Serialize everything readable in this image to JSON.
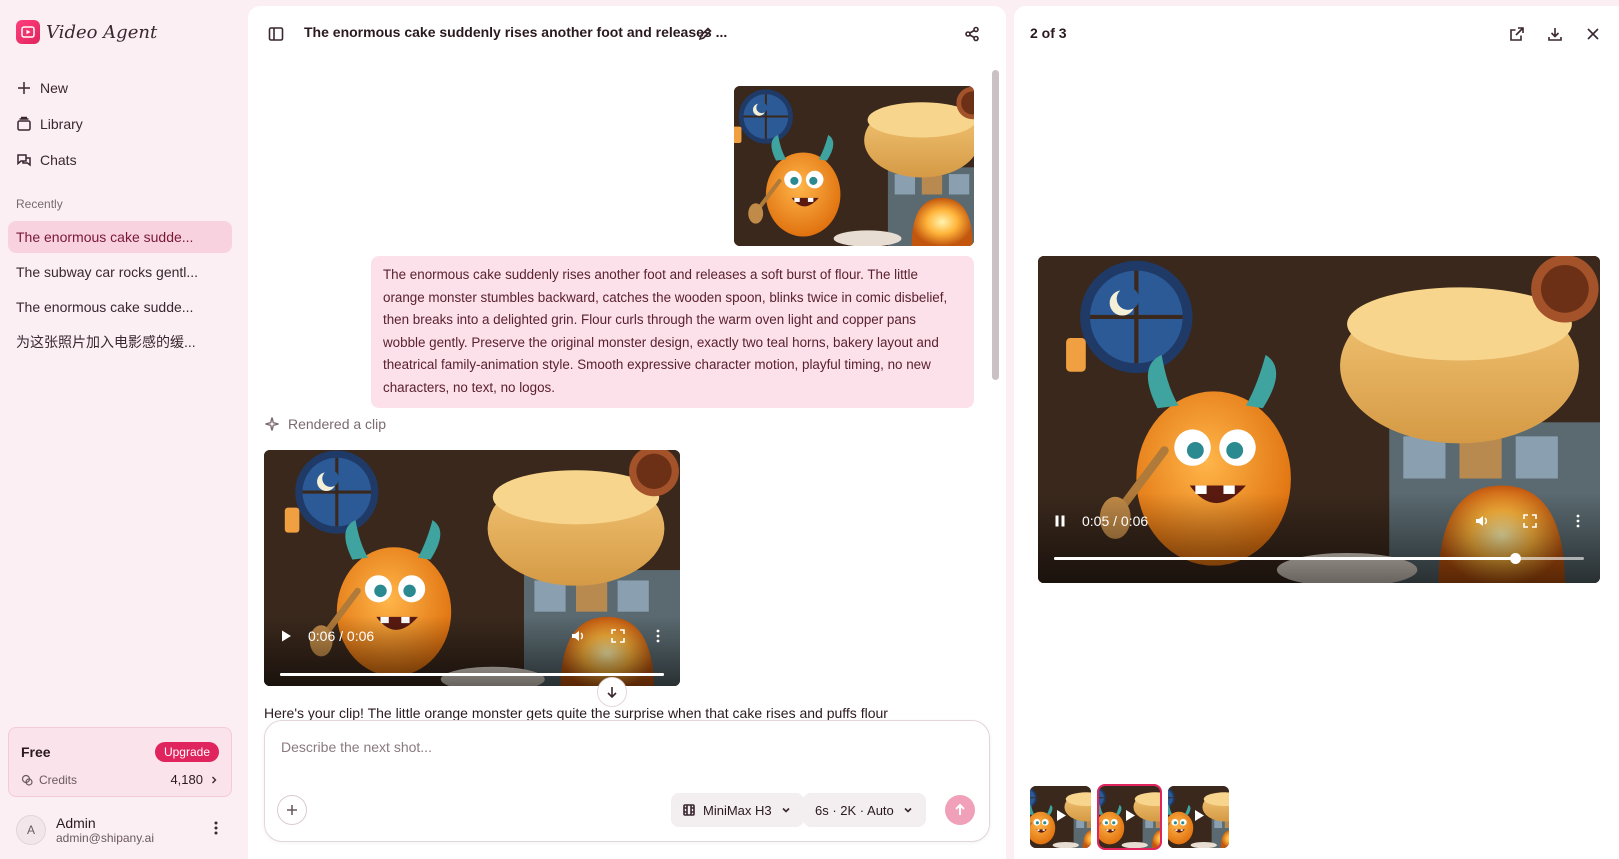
{
  "app": {
    "name": "Video Agent",
    "brand_color": "#e0245e"
  },
  "nav": [
    {
      "label": "New",
      "icon": "plus-icon"
    },
    {
      "label": "Library",
      "icon": "library-icon"
    },
    {
      "label": "Chats",
      "icon": "chats-icon"
    }
  ],
  "recent": {
    "label": "Recently",
    "items": [
      {
        "label": "The enormous cake sudde...",
        "active": true
      },
      {
        "label": "The subway car rocks gentl...",
        "active": false
      },
      {
        "label": "The enormous cake sudde...",
        "active": false
      },
      {
        "label": "为这张照片加入电影感的缓...",
        "active": false
      }
    ]
  },
  "plan": {
    "name": "Free",
    "upgrade_label": "Upgrade",
    "credits_label": "Credits",
    "credits_value": "4,180"
  },
  "user": {
    "initial": "A",
    "name": "Admin",
    "email": "admin@shipany.ai"
  },
  "chat": {
    "title": "The enormous cake suddenly rises another foot and releases ...",
    "message": "The enormous cake suddenly rises another foot and releases a soft burst of flour. The little orange monster stumbles backward, catches the wooden spoon, blinks twice in comic disbelief, then breaks into a delighted grin. Flour curls through the warm oven light and copper pans wobble gently. Preserve the original monster design, exactly two teal horns, bakery layout and theatrical family-animation style. Smooth expressive character motion, playful timing, no new characters, no text, no logos.",
    "rendered_label": "Rendered a clip",
    "clip_time": "0:06",
    "clip_duration": "0:06",
    "clip_progress": 1.0,
    "assistant_text": "Here's your clip! The little orange monster gets quite the surprise when that cake rises and puffs flour",
    "composer_placeholder": "Describe the next shot...",
    "model_label": "MiniMax H3",
    "settings_label": "6s · 2K · Auto"
  },
  "preview": {
    "count_label": "2 of 3",
    "time": "0:05",
    "duration": "0:06",
    "progress": 0.87,
    "thumbs": [
      {
        "active": false
      },
      {
        "active": true
      },
      {
        "active": false
      }
    ]
  }
}
